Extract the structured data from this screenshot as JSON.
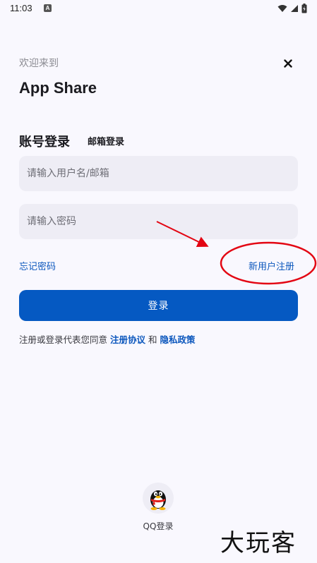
{
  "status_bar": {
    "time": "11:03",
    "notification_icon": "A",
    "icons": [
      "wifi-icon",
      "signal-icon",
      "battery-icon"
    ]
  },
  "header": {
    "welcome": "欢迎来到",
    "title": "App Share",
    "close_icon": "close-icon"
  },
  "tabs": {
    "account_login": "账号登录",
    "email_login": "邮箱登录"
  },
  "form": {
    "username_placeholder": "请输入用户名/邮箱",
    "password_placeholder": "请输入密码",
    "username_value": "",
    "password_value": ""
  },
  "links": {
    "forgot_password": "忘记密码",
    "register": "新用户注册"
  },
  "login_button": "登录",
  "agreement": {
    "prefix": "注册或登录代表您同意 ",
    "terms": "注册协议",
    "conjunction": " 和 ",
    "privacy": "隐私政策"
  },
  "third_party": {
    "qq_label": "QQ登录",
    "qq_icon": "qq-penguin-icon"
  },
  "watermark": "大玩客",
  "colors": {
    "accent": "#0559c2",
    "link": "#0c57bd",
    "background": "#f9f8fe",
    "input_bg": "#eeedf5",
    "annotation": "#e30613"
  }
}
